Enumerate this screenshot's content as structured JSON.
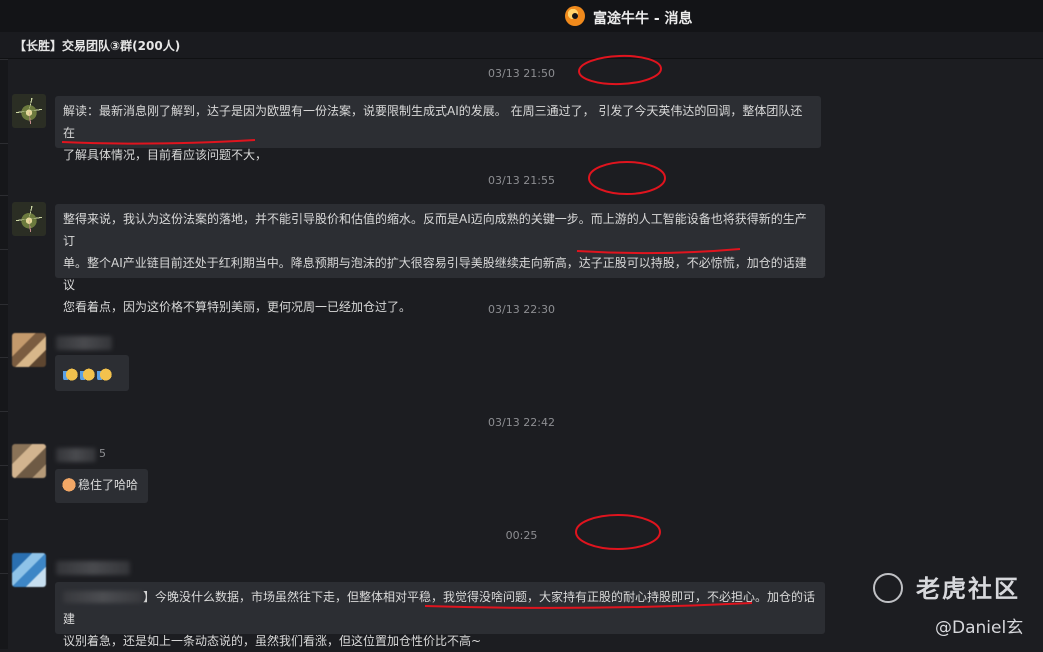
{
  "window": {
    "title": "富途牛牛 - 消息",
    "app_icon": "futu-logo-icon"
  },
  "group": {
    "name": "【长胜】交易团队③群(200人)"
  },
  "messages": [
    {
      "time": "03/13 21:50",
      "text": "解读：最新消息刚了解到，达子是因为欧盟有一份法案，说要限制生成式AI的发展。 在周三通过了， 引发了今天英伟达的回调，整体团队还在了解具体情况，目前看应该问题不大，",
      "lines": [
        "解读：最新消息刚了解到，达子是因为欧盟有一份法案，说要限制生成式AI的发展。 在周三通过了， 引发了今天英伟达的回调，整体团队还在",
        "了解具体情况，目前看应该问题不大，"
      ]
    },
    {
      "time": "03/13 21:55",
      "lines": [
        "整得来说，我认为这份法案的落地，并不能引导股价和估值的缩水。反而是AI迈向成熟的关键一步。而上游的人工智能设备也将获得新的生产订",
        "单。整个AI产业链目前还处于红利期当中。降息预期与泡沫的扩大很容易引导美股继续走向新高，达子正股可以持股，不必惊慌，加仓的话建议",
        "您看着点，因为这价格不算特别美丽，更何况周一已经加仓过了。"
      ]
    },
    {
      "time": "03/13 22:30",
      "emoji": "thumbs-up-icon x3"
    },
    {
      "time": "03/13 22:42",
      "sender_suffix": "5",
      "text": "稳住了哈哈",
      "emoji": "cat-face-icon"
    },
    {
      "time": "00:25",
      "lines": [
        "】今晚没什么数据，市场虽然往下走，但整体相对平稳，我觉得没啥问题，大家持有正股的耐心持股即可，不必担心。加仓的话建",
        "议别着急，还是如上一条动态说的，虽然我们看涨，但这位置加仓性价比不高~"
      ]
    }
  ],
  "watermark": {
    "brand": "老虎社区",
    "user": "@Daniel玄"
  },
  "colors": {
    "background": "#1c1d21",
    "bubble": "#2c2e33",
    "annotation": "#e0141e"
  }
}
